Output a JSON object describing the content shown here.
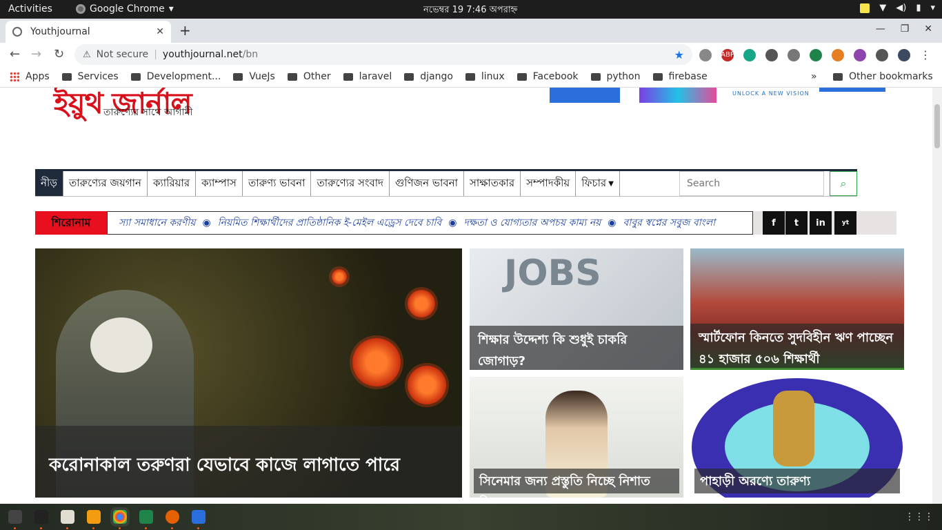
{
  "system": {
    "activities": "Activities",
    "app_name": "Google Chrome",
    "clock": "নভেম্বর 19   7:46 অপরাহ্ন"
  },
  "browser": {
    "tab_title": "Youthjournal",
    "not_secure": "Not secure",
    "url_host": "youthjournal.net",
    "url_path": "/bn",
    "bookmarks": [
      "Apps",
      "Services",
      "Development...",
      "VueJs",
      "Other",
      "laravel",
      "django",
      "linux",
      "Facebook",
      "python",
      "firebase"
    ],
    "other_bookmarks": "Other bookmarks",
    "more": "»"
  },
  "site": {
    "logo_text": "ইয়ুথ জার্নাল",
    "tagline": "তারুণ্যের সাথে আগামী",
    "ad_text": "UNLOCK A NEW VISION",
    "nav": [
      "নীড়",
      "তারুণ্যের জয়গান",
      "ক্যারিয়ার",
      "ক্যাম্পাস",
      "তারুণ্য ভাবনা",
      "তারুণ্যের সংবাদ",
      "গুণিজন ভাবনা",
      "সাক্ষাতকার",
      "সম্পাদকীয়",
      "ফিচার"
    ],
    "search_placeholder": "Search",
    "ticker_label": "শিরোনাম",
    "ticker_items": [
      "স্যা সমাধানে করণীয়",
      "নিয়মিত শিক্ষার্থীদের প্রাতিষ্ঠানিক ই-মেইল এড্রেস দেবে চাবি",
      "দক্ষতা ও যোগ্যতার অপচয় কাম্য নয়",
      "বাবুর স্বপ্নের সবুজ বাংলা"
    ],
    "social": [
      "f",
      "t",
      "in",
      "yt"
    ],
    "jobs_word": "JOBS",
    "stories": {
      "main": "করোনাকাল তরুণরা যেভাবে কাজে লাগাতে পারে",
      "jobs": "শিক্ষার উদ্দেশ্য কি শুধুই চাকরি জোগাড়?",
      "campus": "স্মার্টফোন কিনতে সুদবিহীন ঋণ পাচ্ছেন ৪১ হাজার ৫০৬ শিক্ষার্থী",
      "film": "সিনেমার জন্য প্রস্তুতি নিচ্ছে নিশাত প্রিয়ম",
      "hills": "পাহাড়ী অরণ্যে তারুণ্য"
    }
  },
  "colors": {
    "brand_red": "#d7101c",
    "nav_dark": "#1e2a3a",
    "ticker_blue": "#1b3f9e",
    "search_green": "#28a745"
  }
}
